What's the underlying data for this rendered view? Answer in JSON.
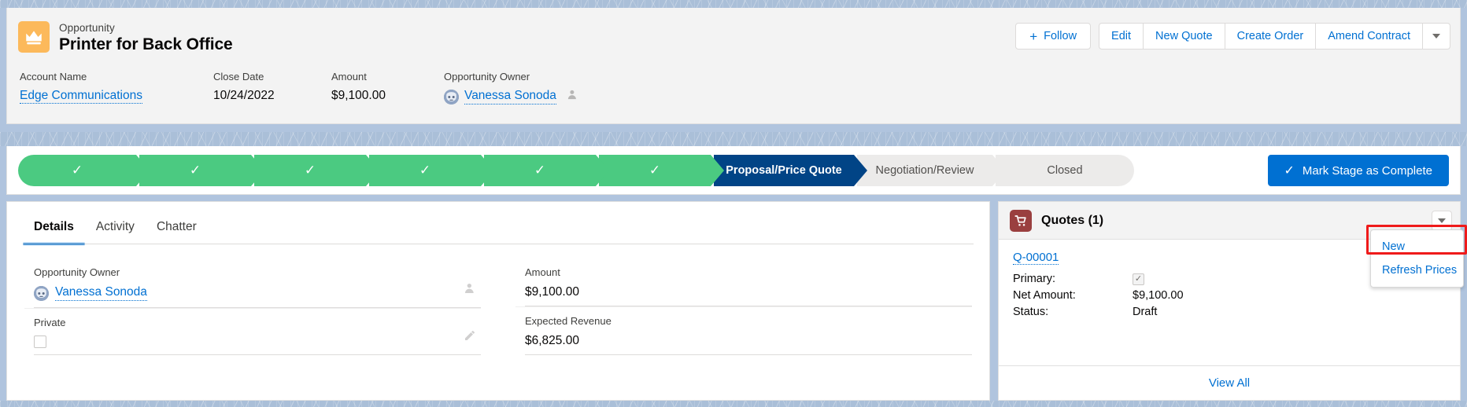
{
  "header": {
    "record_type": "Opportunity",
    "record_title": "Printer for Back Office",
    "record_icon": "crown-icon",
    "actions": {
      "follow": "Follow",
      "edit": "Edit",
      "new_quote": "New Quote",
      "create_order": "Create Order",
      "amend_contract": "Amend Contract",
      "more_icon": "chevron-down-icon"
    },
    "fields": [
      {
        "label": "Account Name",
        "value": "Edge Communications",
        "type": "link"
      },
      {
        "label": "Close Date",
        "value": "10/24/2022",
        "type": "text"
      },
      {
        "label": "Amount",
        "value": "$9,100.00",
        "type": "text"
      },
      {
        "label": "Opportunity Owner",
        "value": "Vanessa Sonoda",
        "type": "owner"
      }
    ]
  },
  "path": {
    "stages": [
      {
        "label": "",
        "state": "done"
      },
      {
        "label": "",
        "state": "done"
      },
      {
        "label": "",
        "state": "done"
      },
      {
        "label": "",
        "state": "done"
      },
      {
        "label": "",
        "state": "done"
      },
      {
        "label": "",
        "state": "done"
      },
      {
        "label": "Proposal/Price Quote",
        "state": "current"
      },
      {
        "label": "Negotiation/Review",
        "state": "todo"
      },
      {
        "label": "Closed",
        "state": "todo"
      }
    ],
    "check_glyph": "✓",
    "mark_complete": "Mark Stage as Complete"
  },
  "tabs": [
    {
      "label": "Details",
      "active": true
    },
    {
      "label": "Activity",
      "active": false
    },
    {
      "label": "Chatter",
      "active": false
    }
  ],
  "details": {
    "left": [
      {
        "label": "Opportunity Owner",
        "value": "Vanessa Sonoda",
        "type": "owner-link",
        "action": "change-owner-icon"
      },
      {
        "label": "Private",
        "value": "",
        "type": "checkbox",
        "action": "edit-pencil-icon"
      }
    ],
    "right": [
      {
        "label": "Amount",
        "value": "$9,100.00",
        "type": "text"
      },
      {
        "label": "Expected Revenue",
        "value": "$6,825.00",
        "type": "text"
      }
    ]
  },
  "quotes_panel": {
    "icon": "cart-icon",
    "title": "Quotes (1)",
    "menu_icon": "chevron-down-icon",
    "record": {
      "name": "Q-00001",
      "rows": [
        {
          "key": "Primary:",
          "value": "",
          "type": "checkbox-checked"
        },
        {
          "key": "Net Amount:",
          "value": "$9,100.00",
          "type": "text"
        },
        {
          "key": "Status:",
          "value": "Draft",
          "type": "text"
        }
      ]
    },
    "view_all": "View All",
    "menu": {
      "items": [
        {
          "label": "New",
          "highlighted": true
        },
        {
          "label": "Refresh Prices",
          "highlighted": false
        }
      ]
    }
  },
  "colors": {
    "brand_blue": "#0070d2",
    "path_done": "#4bca81",
    "path_current": "#014486",
    "annotation_red": "#ef1a1a",
    "record_icon_bg": "#fcb95b",
    "quotes_icon_bg": "#9a3f3f"
  }
}
